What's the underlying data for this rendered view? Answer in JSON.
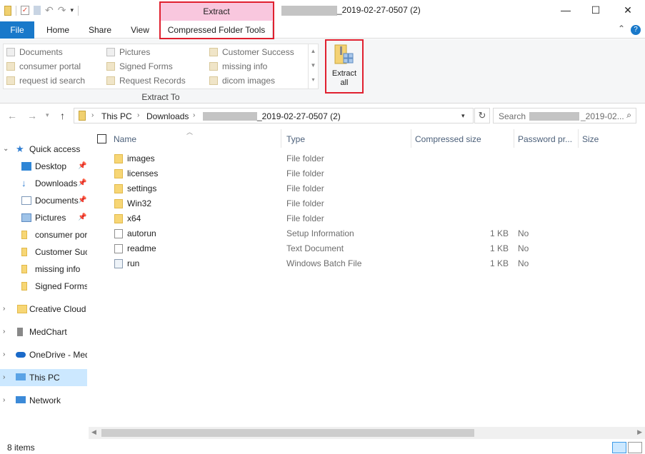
{
  "titlebar": {
    "context_label": "Extract",
    "title_suffix": "_2019-02-27-0507 (2)",
    "minimize": "—",
    "maximize": "☐",
    "close": "✕"
  },
  "tabs": {
    "file": "File",
    "home": "Home",
    "share": "Share",
    "view": "View",
    "context_tab": "Compressed Folder Tools"
  },
  "ribbon": {
    "gallery_items": [
      {
        "label": "Documents",
        "icon": "documents-icon"
      },
      {
        "label": "Pictures",
        "icon": "pictures-icon"
      },
      {
        "label": "Customer Success",
        "icon": "folder-icon"
      },
      {
        "label": "consumer portal",
        "icon": "folder-icon"
      },
      {
        "label": "Signed Forms",
        "icon": "folder-icon"
      },
      {
        "label": "missing info",
        "icon": "folder-icon"
      },
      {
        "label": "request id search",
        "icon": "folder-icon"
      },
      {
        "label": "Request Records",
        "icon": "folder-icon"
      },
      {
        "label": "dicom images",
        "icon": "folder-icon"
      }
    ],
    "group_label": "Extract To",
    "extract_all_line1": "Extract",
    "extract_all_line2": "all",
    "help": "?",
    "collapse": "⌃"
  },
  "address": {
    "crumbs": [
      "This PC",
      "Downloads",
      "_2019-02-27-0507 (2)"
    ],
    "search_prefix": "Search ",
    "search_suffix": "_2019-02..."
  },
  "nav": {
    "items": [
      {
        "label": "Quick access",
        "icon": "star-icon"
      },
      {
        "label": "Desktop",
        "icon": "desktop-icon"
      },
      {
        "label": "Downloads",
        "icon": "download-icon"
      },
      {
        "label": "Documents",
        "icon": "documents-icon"
      },
      {
        "label": "Pictures",
        "icon": "pictures-icon"
      },
      {
        "label": "consumer portal",
        "icon": "folder-icon"
      },
      {
        "label": "Customer Success",
        "icon": "folder-icon"
      },
      {
        "label": "missing info",
        "icon": "folder-icon"
      },
      {
        "label": "Signed Forms",
        "icon": "folder-icon"
      },
      {
        "label": "Creative Cloud Files",
        "icon": "creative-cloud-icon"
      },
      {
        "label": "MedChart",
        "icon": "drive-icon"
      },
      {
        "label": "OneDrive - MedChart",
        "icon": "onedrive-icon"
      },
      {
        "label": "This PC",
        "icon": "computer-icon"
      },
      {
        "label": "Network",
        "icon": "network-icon"
      }
    ]
  },
  "columns": {
    "name": "Name",
    "type": "Type",
    "compressed_size": "Compressed size",
    "password": "Password pr...",
    "size": "Size"
  },
  "files": [
    {
      "name": "images",
      "type": "File folder",
      "size": "",
      "password": "",
      "icon": "folder"
    },
    {
      "name": "licenses",
      "type": "File folder",
      "size": "",
      "password": "",
      "icon": "folder"
    },
    {
      "name": "settings",
      "type": "File folder",
      "size": "",
      "password": "",
      "icon": "folder"
    },
    {
      "name": "Win32",
      "type": "File folder",
      "size": "",
      "password": "",
      "icon": "folder"
    },
    {
      "name": "x64",
      "type": "File folder",
      "size": "",
      "password": "",
      "icon": "folder"
    },
    {
      "name": "autorun",
      "type": "Setup Information",
      "size": "1 KB",
      "password": "No",
      "icon": "setup"
    },
    {
      "name": "readme",
      "type": "Text Document",
      "size": "1 KB",
      "password": "No",
      "icon": "text"
    },
    {
      "name": "run",
      "type": "Windows Batch File",
      "size": "1 KB",
      "password": "No",
      "icon": "batch"
    }
  ],
  "status": {
    "item_count": "8 items"
  },
  "colors": {
    "file_tab": "#1979ca",
    "context_tab_highlight": "#f9c7de",
    "annotation_red": "#e0202f",
    "selected_nav": "#cce8ff"
  }
}
